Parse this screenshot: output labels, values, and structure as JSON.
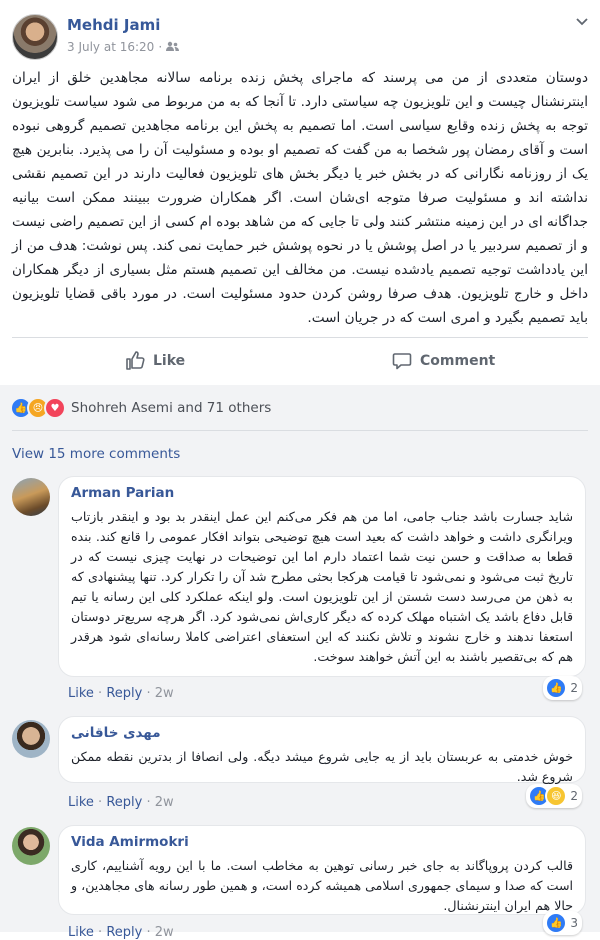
{
  "post": {
    "author": "Mehdi Jami",
    "date": "3 July at 16:20",
    "dot": "·",
    "privacy_icon": "friends-icon",
    "menu_icon": "chevron-down-icon",
    "body": "دوستان متعددی از من می پرسند که ماجرای پخش زنده برنامه سالانه مجاهدین خلق از ایران اینترنشنال چیست و این تلویزیون چه سیاستی دارد. تا آنجا که به من مربوط می شود سیاست تلویزیون توجه به پخش زنده وقایع سیاسی است. اما تصمیم به پخش این برنامه مجاهدین تصمیم گروهی نبوده است و آقای رمضان پور شخصا به من گفت که تصمیم او بوده و مسئولیت آن را می پذیرد. بنابرین هیچ یک از روزنامه نگارانی که در بخش خبر یا دیگر بخش های تلویزیون فعالیت دارند در این تصمیم نقشی نداشته اند و مسئولیت صرفا متوجه ای‌شان است. اگر همکاران ضرورت ببینند ممکن است بیانیه جداگانه ای در این زمینه منتشر کنند ولی تا جایی که من شاهد بوده ام کسی از این تصمیم راضی نیست و از تصمیم سردبیر یا در اصل پوشش یا در نحوه پوشش خبر حمایت نمی کند. پس نوشت: هدف من از این یادداشت توجیه تصمیم یادشده نیست. من مخالف این تصمیم هستم مثل بسیاری از دیگر همکاران داخل و خارج تلویزیون. هدف صرفا روشن کردن حدود مسئولیت است. در مورد باقی قضایا تلویزیون باید تصمیم بگیرد و امری است که در جریان است."
  },
  "actions": {
    "like_label": "Like",
    "comment_label": "Comment"
  },
  "reactions": {
    "summary": "Shohreh Asemi and 71 others",
    "types": [
      "like",
      "angry",
      "love"
    ]
  },
  "view_more": "View 15 more comments",
  "comments": [
    {
      "name": "Arman Parian",
      "text": "شاید جسارت باشد جناب جامی، اما من هم فکر می‌کنم این عمل اینقدر بد بود و اینقدر بازتاب ویرانگری داشت و خواهد داشت که بعید است هیچ توضیحی بتواند افکار عمومی را قانع کند. بنده قطعا به صداقت و حسن نیت شما اعتماد دارم اما این توضیحات در نهایت چیزی نیست که در تاریخ ثبت می‌شود و نمی‌شود تا قیامت هرکجا بحثی مطرح شد آن را تکرار کرد. تنها پیشنهادی که به ذهن من می‌رسد دست شستن از این تلویزیون است. ولو اینکه عملکرد کلی این رسانه یا تیم قابل دفاع باشد یک اشتباه مهلک کرده که دیگر کاری‌اش نمی‌شود کرد. اگر هرچه سریع‌تر دوستان استعفا ندهند و خارج نشوند و تلاش نکنند که این استعفای اعتراضی کاملا رسانه‌ای شود هرقدر هم که بی‌تقصیر باشند به این آتش خواهند سوخت.",
      "like": "Like",
      "reply": "Reply",
      "time": "2w",
      "reaction_count": "2"
    },
    {
      "name": "مهدی خاقانی",
      "text": "خوش خدمتی به عربستان باید از یه جایی شروع میشد دیگه. ولی انصافا از بدترین نقطه ممکن شروع شد.",
      "like": "Like",
      "reply": "Reply",
      "time": "2w",
      "reaction_count": "2"
    },
    {
      "name": "Vida Amirmokri",
      "text": "قالب کردن پروپاگاند به جای خبر رسانی توهین به مخاطب است. ما با این رویه آشناییم، کاری است که صدا و سیمای جمهوری اسلامی همیشه کرده است، و همین طور رسانه های مجاهدین، و حالا هم ایران اینترنشنال.",
      "like": "Like",
      "reply": "Reply",
      "time": "2w",
      "reaction_count": "3"
    }
  ]
}
